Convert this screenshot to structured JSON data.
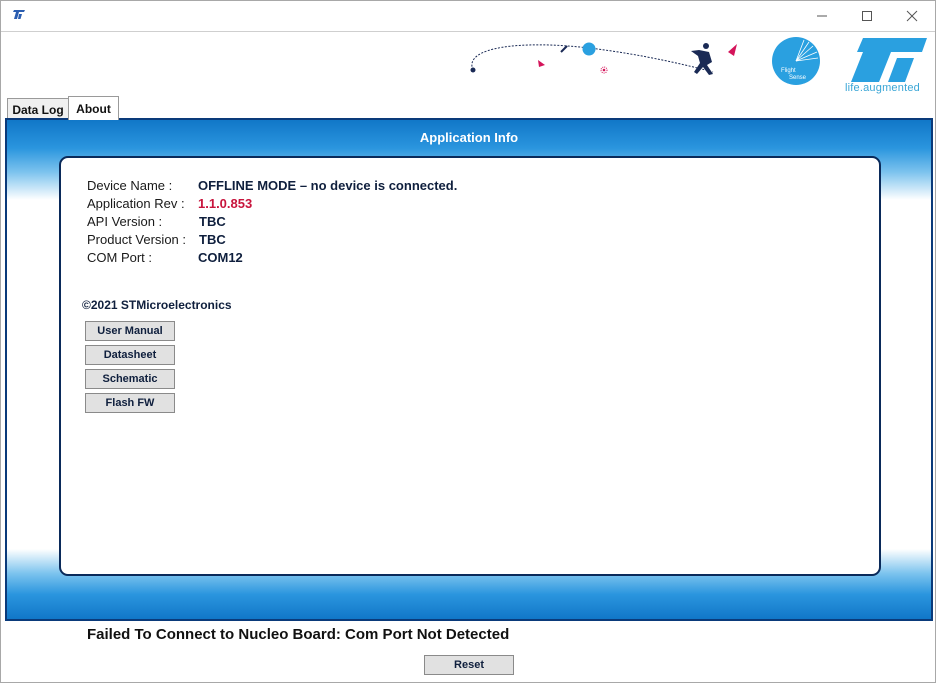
{
  "titlebar": {
    "icon": "st-logo-icon",
    "controls": [
      "minimize-icon",
      "maximize-icon",
      "close-icon"
    ]
  },
  "banner": {
    "logo_text": "ST",
    "tagline": "life.augmented",
    "badge_text": [
      "Flight",
      "Sense"
    ]
  },
  "tabs": [
    {
      "label": "Data Log",
      "selected": false
    },
    {
      "label": "About",
      "selected": true
    }
  ],
  "panel": {
    "title": "Application Info",
    "info": {
      "device_name_label": "Device Name :",
      "device_name_value": "OFFLINE MODE – no device is connected.",
      "app_rev_label": "Application Rev :",
      "app_rev_value": "1.1.0.853",
      "api_version_label": "API Version :",
      "api_version_value": "TBC",
      "product_version_label": "Product Version :",
      "product_version_value": "TBC",
      "com_port_label": "COM Port :",
      "com_port_value": "COM12"
    },
    "copyright": "©2021 STMicroelectronics",
    "buttons": {
      "user_manual": "User Manual",
      "datasheet": "Datasheet",
      "schematic": "Schematic",
      "flash_fw": "Flash FW"
    }
  },
  "status": {
    "message": "Failed To Connect to Nucleo Board:  Com Port Not Detected",
    "reset_label": "Reset"
  },
  "colors": {
    "accent_blue": "#1177c8",
    "frame_navy": "#0a3a7a",
    "rev_red": "#c8143c",
    "st_blue": "#3aa6d6"
  }
}
